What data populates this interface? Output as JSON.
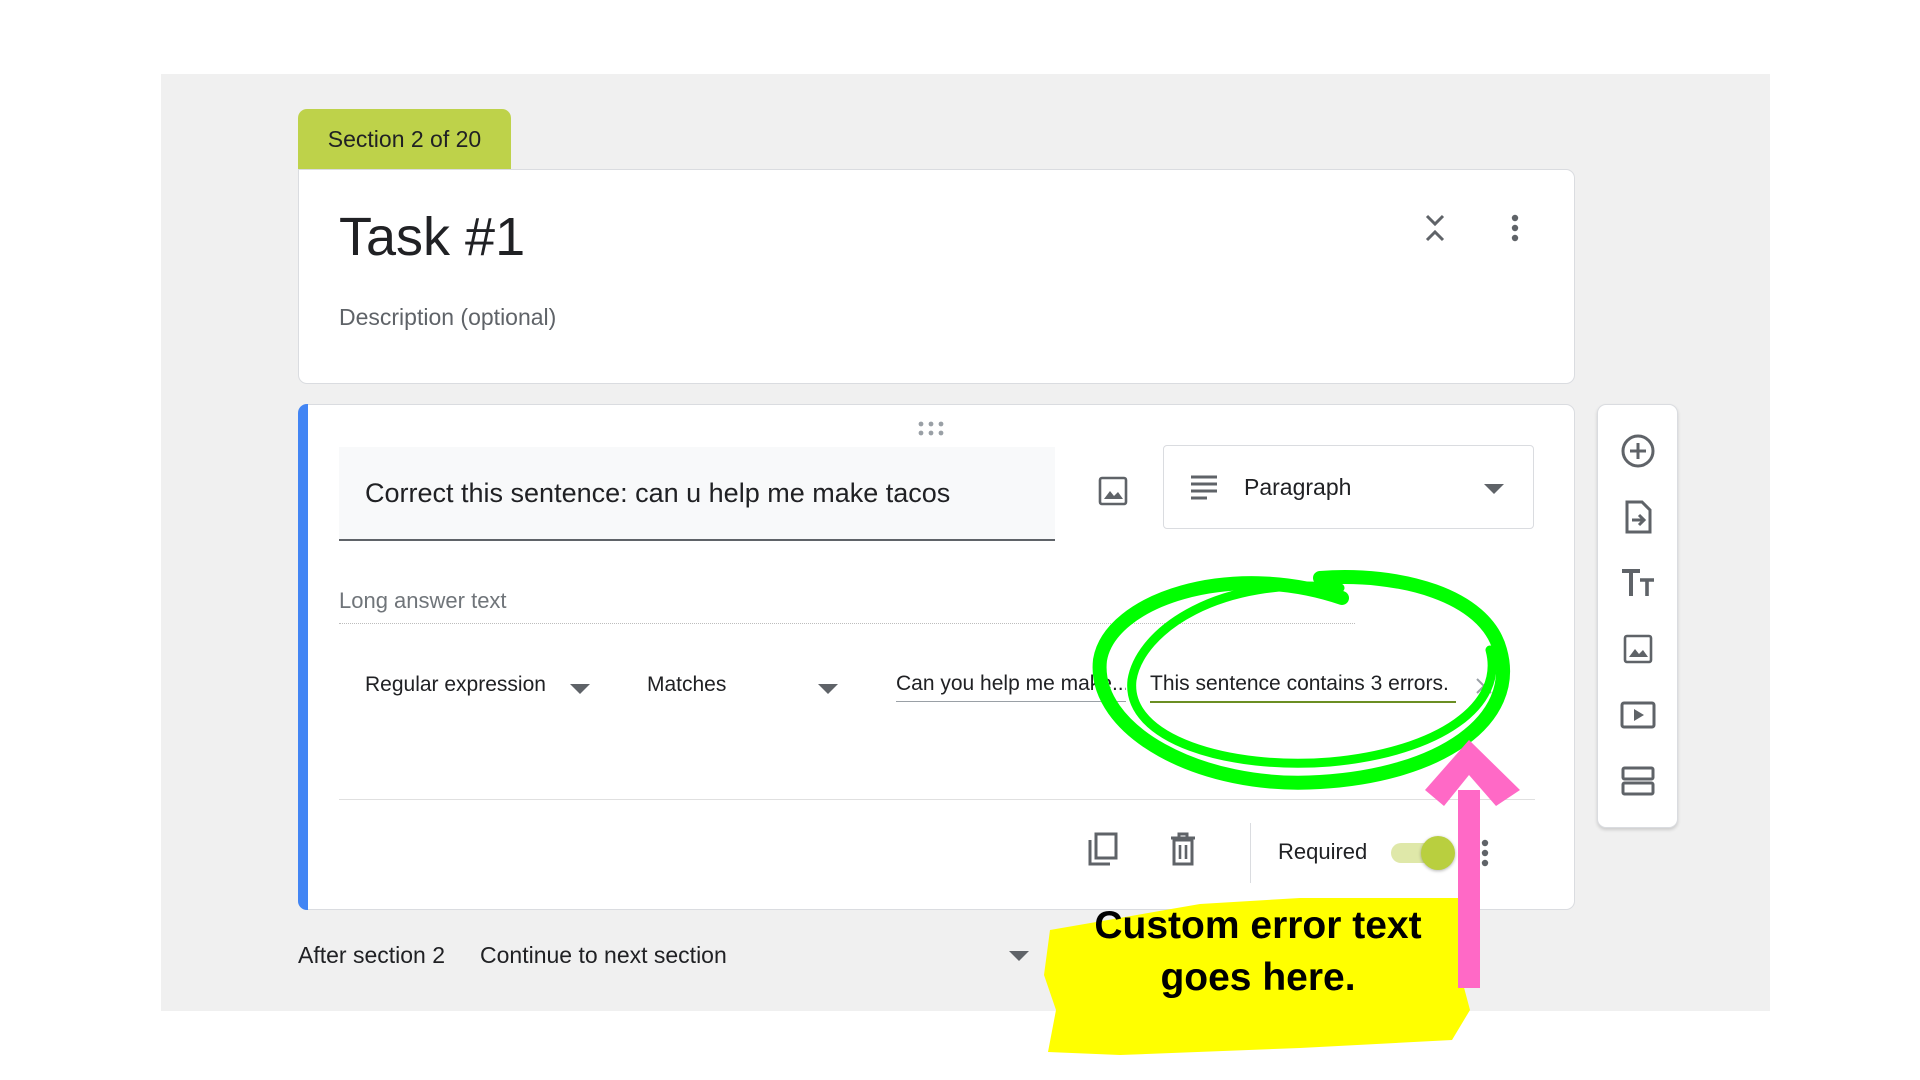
{
  "section_tab": {
    "label": "Section 2 of 20"
  },
  "header": {
    "title": "Task #1",
    "description_placeholder": "Description (optional)",
    "collapse_icon": "collapse-icon",
    "more_icon": "more-vert-icon"
  },
  "question": {
    "title": "Correct this sentence: can u help me make tacos",
    "image_icon": "image-icon",
    "type_select": {
      "icon": "paragraph-icon",
      "label": "Paragraph"
    },
    "answer_placeholder": "Long answer text",
    "validation": {
      "type": "Regular expression",
      "condition": "Matches",
      "pattern": "Can you help me make...",
      "error_text": "This sentence contains 3 errors."
    },
    "footer": {
      "required_label": "Required",
      "required_on": true
    }
  },
  "after_section": {
    "label": "After section 2",
    "value": "Continue to next section"
  },
  "side_toolbar": {
    "items": [
      "add-question-icon",
      "import-questions-icon",
      "add-title-icon",
      "add-image-icon",
      "add-video-icon",
      "add-section-icon"
    ]
  },
  "annotation": {
    "line1": "Custom error text",
    "line2": "goes here.",
    "circle_color": "#00ff00",
    "arrow_color": "#ff69c6",
    "highlight_color": "#ffff00"
  },
  "colors": {
    "accent": "#bed24a",
    "question_bar": "#4285f4",
    "canvas": "#f0f0f0"
  }
}
